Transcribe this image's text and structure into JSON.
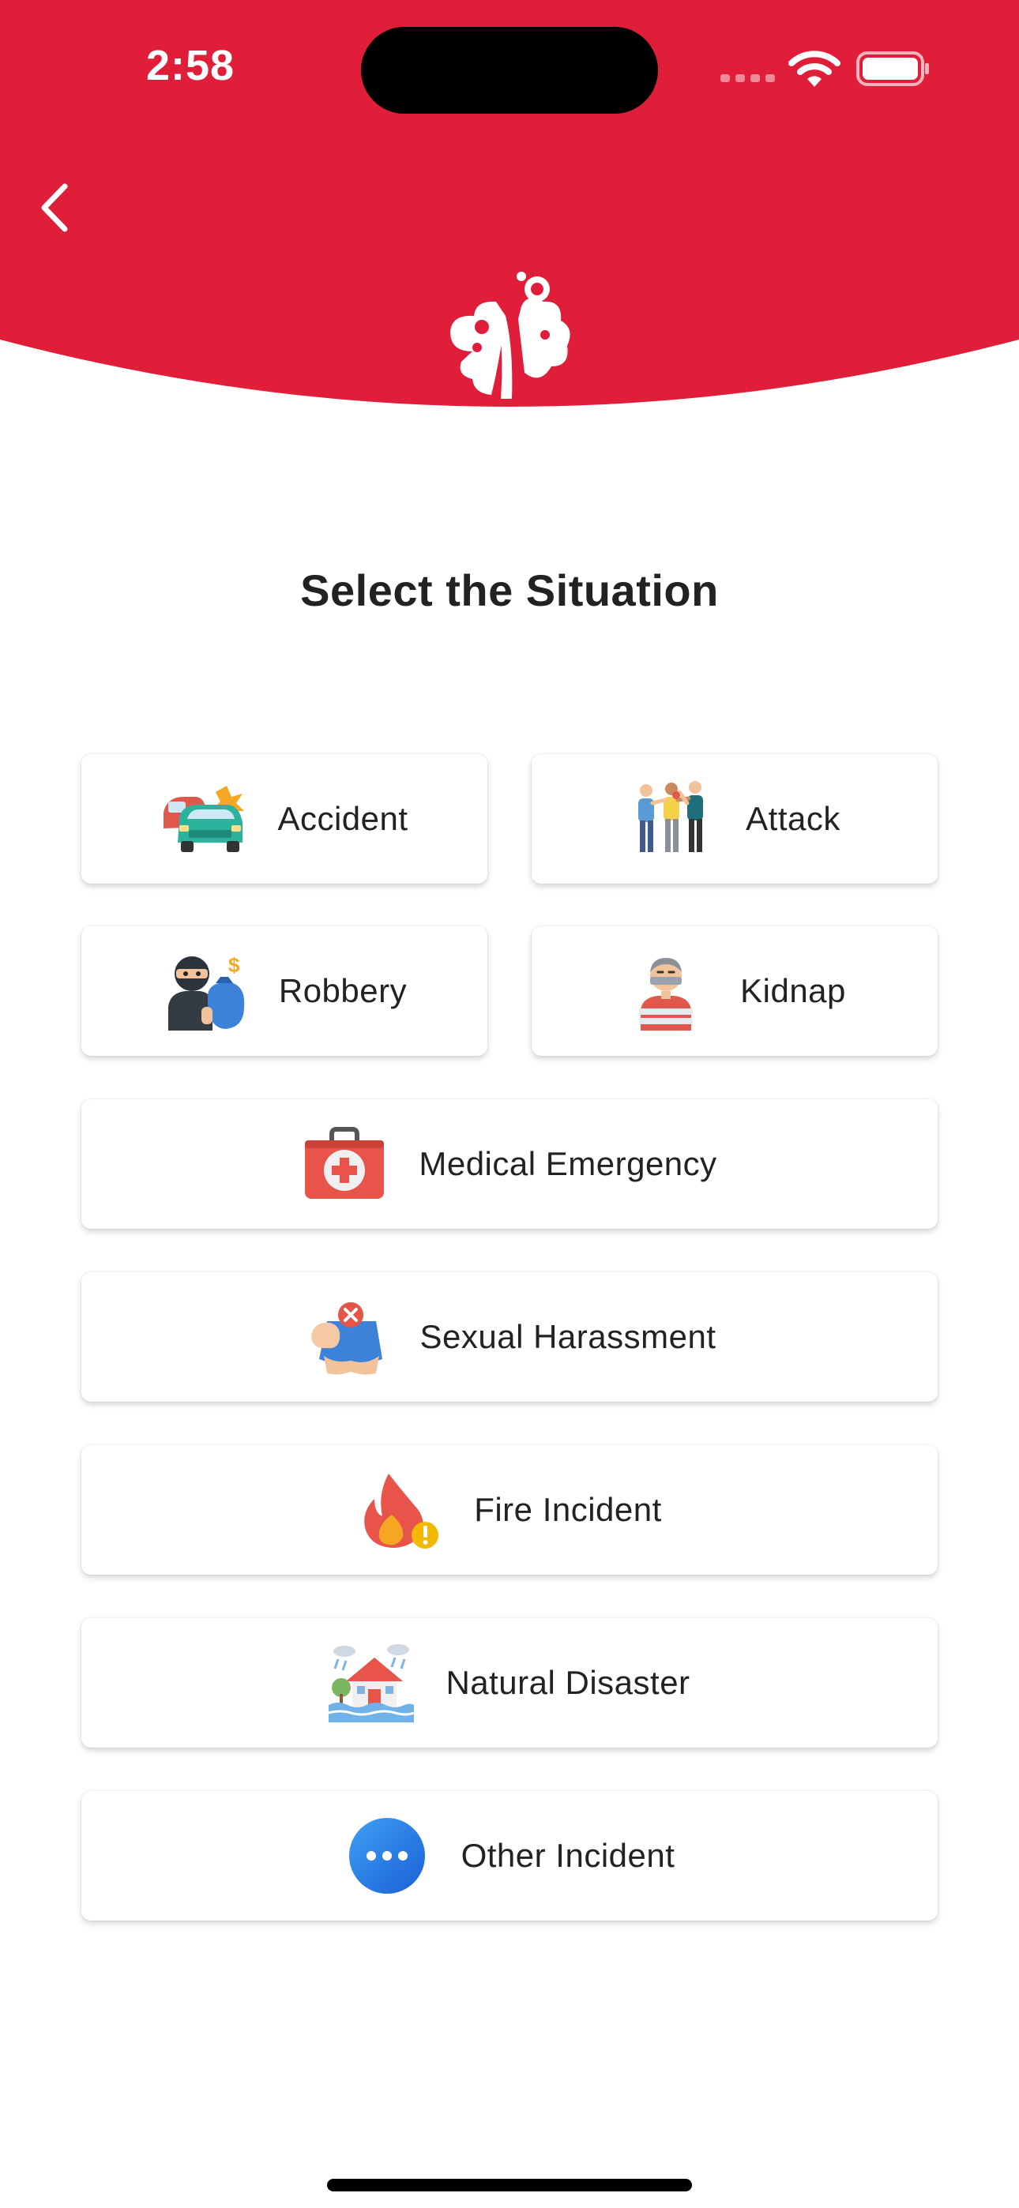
{
  "status_bar": {
    "time": "2:58"
  },
  "header": {
    "brand_color": "#e01e3a",
    "back_icon": "chevron-left-icon",
    "logo_icon": "app-logo-icon"
  },
  "page": {
    "title": "Select the Situation"
  },
  "situations": [
    {
      "label": "Accident",
      "icon": "car-crash-icon"
    },
    {
      "label": "Attack",
      "icon": "fight-icon"
    },
    {
      "label": "Robbery",
      "icon": "robber-icon"
    },
    {
      "label": "Kidnap",
      "icon": "kidnap-icon"
    },
    {
      "label": "Medical Emergency",
      "icon": "first-aid-kit-icon"
    },
    {
      "label": "Sexual Harassment",
      "icon": "harassment-icon"
    },
    {
      "label": "Fire Incident",
      "icon": "fire-icon"
    },
    {
      "label": "Natural Disaster",
      "icon": "flood-house-icon"
    },
    {
      "label": "Other Incident",
      "icon": "more-dots-icon"
    }
  ]
}
